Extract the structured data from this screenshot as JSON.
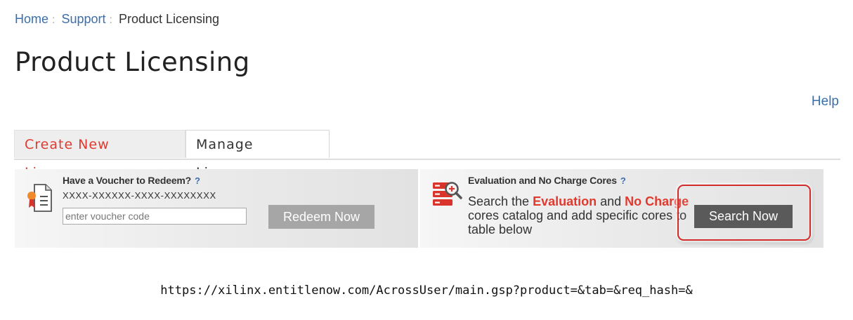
{
  "breadcrumb": {
    "home": "Home",
    "support": "Support",
    "current": "Product Licensing",
    "separator": ":"
  },
  "page": {
    "title": "Product Licensing",
    "help": "Help"
  },
  "tabs": [
    {
      "label": "Create New Licenses",
      "active": true
    },
    {
      "label": "Manage Licenses",
      "active": false
    }
  ],
  "voucher": {
    "title": "Have a Voucher to Redeem?",
    "help_mark": "?",
    "format": "XXXX-XXXXXX-XXXX-XXXXXXXX",
    "placeholder": "enter voucher code",
    "button": "Redeem Now",
    "icon": "certificate-document-icon"
  },
  "evaluation": {
    "title": "Evaluation and No Charge Cores",
    "help_mark": "?",
    "desc_pre": "Search the ",
    "desc_eval": "Evaluation",
    "desc_and": " and ",
    "desc_nocharge": "No Charge",
    "desc_post": " cores catalog and add specific cores to table below",
    "button": "Search Now",
    "icon": "database-search-icon"
  },
  "url": "https://xilinx.entitlenow.com/AcrossUser/main.gsp?product=&tab=&req_hash=&",
  "colors": {
    "accent": "#e03a2f",
    "link": "#3a6fad",
    "highlight": "#d22b2b"
  }
}
